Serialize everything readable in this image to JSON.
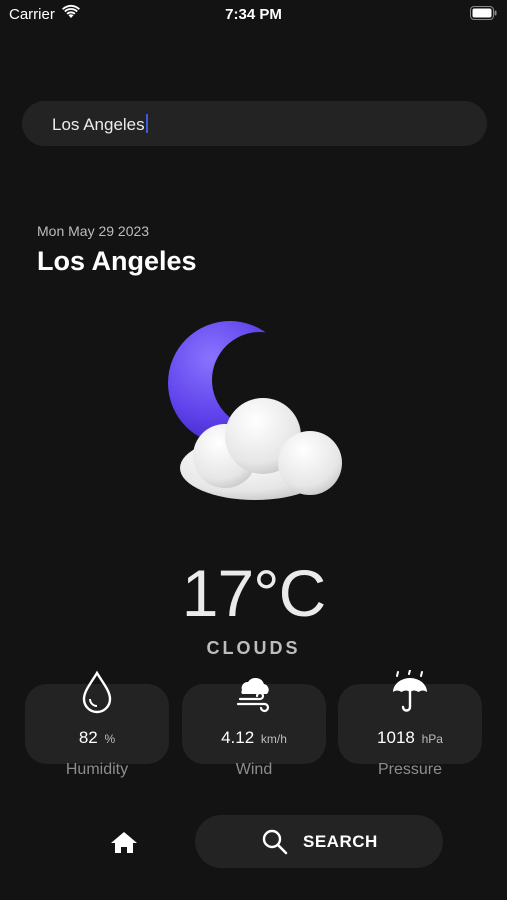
{
  "status_bar": {
    "carrier": "Carrier",
    "time": "7:34 PM"
  },
  "search": {
    "value": "Los Angeles"
  },
  "weather": {
    "date": "Mon May 29 2023",
    "city": "Los Angeles",
    "temperature": "17°C",
    "condition": "CLOUDS",
    "icon": "moon-cloud-icon"
  },
  "stats": [
    {
      "value": "82",
      "unit": "%",
      "label": "Humidity",
      "icon": "water-drop-icon"
    },
    {
      "value": "4.12",
      "unit": "km/h",
      "label": "Wind",
      "icon": "wind-icon"
    },
    {
      "value": "1018",
      "unit": "hPa",
      "label": "Pressure",
      "icon": "umbrella-icon"
    }
  ],
  "nav": {
    "search_label": "SEARCH"
  },
  "colors": {
    "background": "#131313",
    "card": "#232323",
    "moon": "#6b4ff0"
  }
}
